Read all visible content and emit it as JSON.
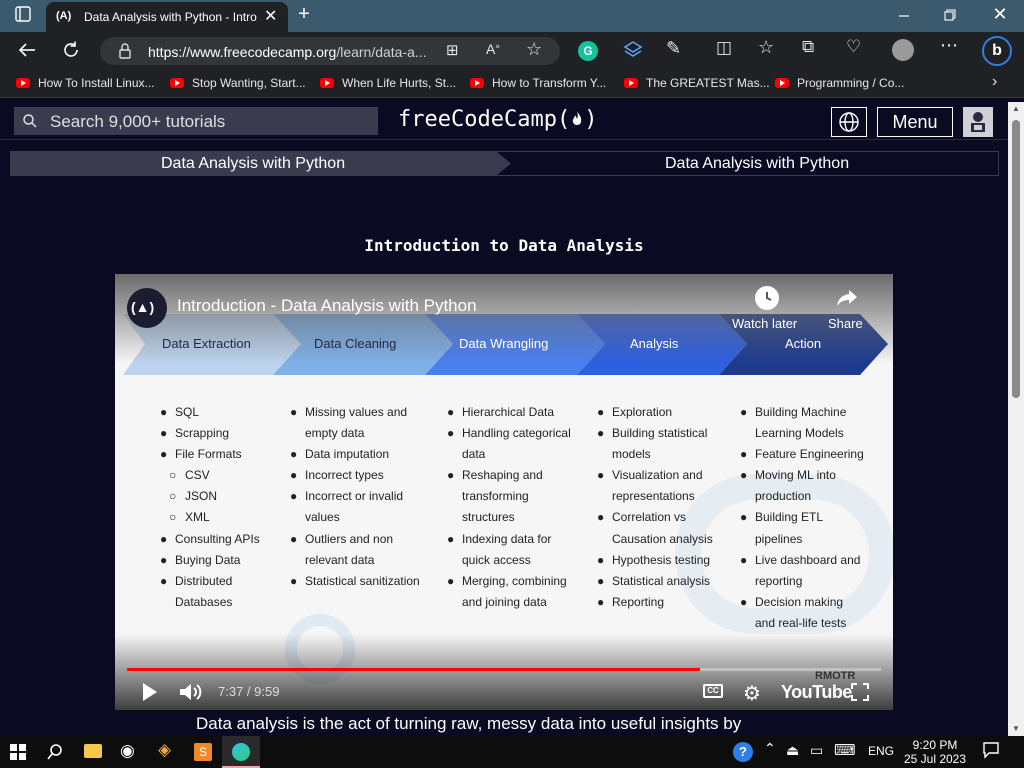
{
  "browser": {
    "tab_title": "Data Analysis with Python - Intro",
    "tab_favicon": "(A)",
    "url_domain": "https://www.freecodecamp.org",
    "url_path": "/learn/data-a...",
    "bookmarks": [
      "How To Install Linux...",
      "Stop Wanting, Start...",
      "When Life Hurts, St...",
      "How to Transform Y...",
      "The GREATEST Mas...",
      "Programming / Co..."
    ]
  },
  "fcc": {
    "search_placeholder": "Search 9,000+ tutorials",
    "logo_text": "freeCodeCamp(",
    "logo_close": ")",
    "menu_label": "Menu",
    "breadcrumb_left": "Data Analysis with Python",
    "breadcrumb_right": "Data Analysis with Python",
    "lesson_title": "Introduction to Data Analysis",
    "description": "Data analysis is the act of turning raw, messy data into useful insights by"
  },
  "video": {
    "title": "Introduction - Data Analysis with Python",
    "watch_later": "Watch later",
    "share": "Share",
    "time": "7:37 / 9:59",
    "progress": 0.76,
    "watermark": "RMOTR",
    "youtube": "YouTube",
    "stages": [
      "Data Extraction",
      "Data Cleaning",
      "Data Wrangling",
      "Analysis",
      "Action"
    ],
    "columns": [
      [
        "SQL",
        "Scrapping",
        "File Formats",
        "CSV",
        "JSON",
        "XML",
        "Consulting APIs",
        "Buying Data",
        "Distributed",
        "Databases"
      ],
      [
        "Missing values and",
        "empty data",
        "Data imputation",
        "Incorrect types",
        "Incorrect or invalid",
        "values",
        "Outliers and non",
        "relevant data",
        "Statistical sanitization"
      ],
      [
        "Hierarchical Data",
        "Handling categorical",
        "data",
        "Reshaping and",
        "transforming",
        "structures",
        "Indexing data for",
        "quick access",
        "Merging, combining",
        "and joining data"
      ],
      [
        "Exploration",
        "Building statistical",
        "models",
        "Visualization and",
        "representations",
        "Correlation vs",
        "Causation analysis",
        "Hypothesis testing",
        "Statistical analysis",
        "Reporting"
      ],
      [
        "Building Machine",
        "Learning Models",
        "Feature Engineering",
        "Moving ML into",
        "production",
        "Building ETL",
        "pipelines",
        "Live dashboard and",
        "reporting",
        "Decision making",
        "and real-life tests"
      ]
    ]
  },
  "taskbar": {
    "language": "ENG",
    "time": "9:20 PM",
    "date": "25 Jul 2023"
  }
}
